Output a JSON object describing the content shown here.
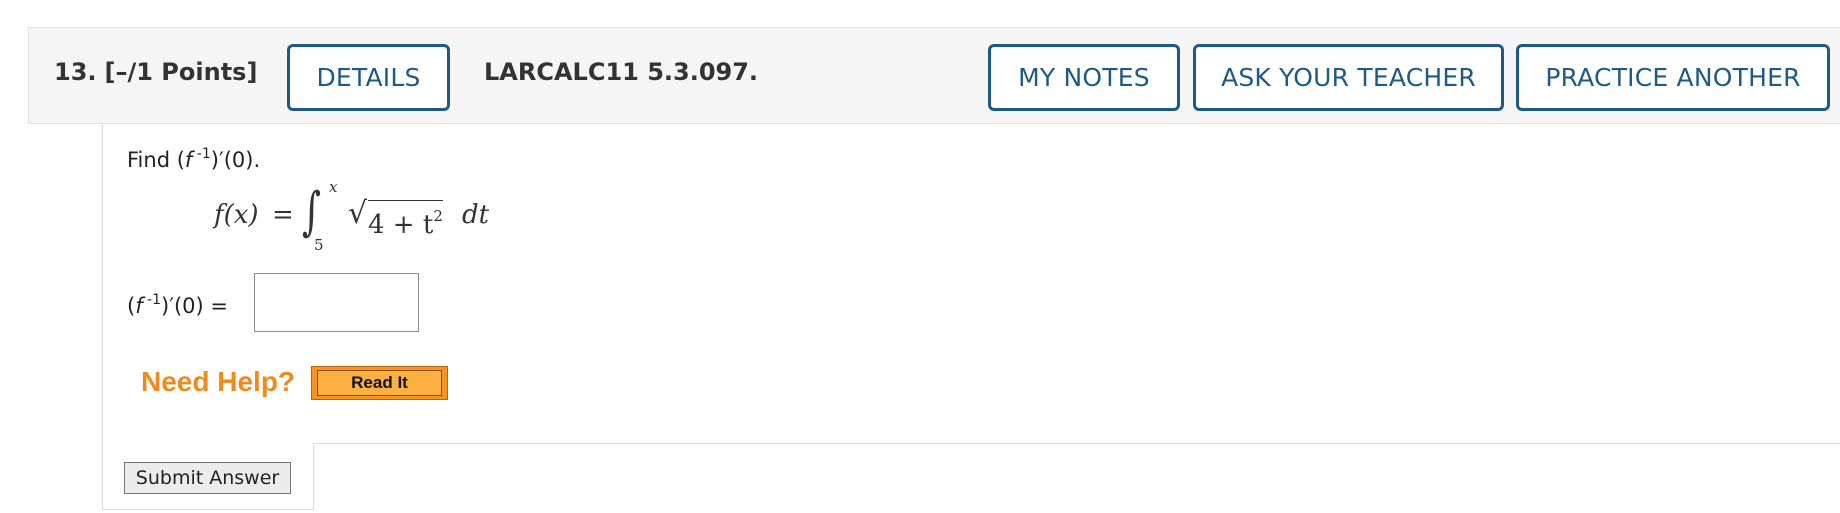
{
  "question": {
    "number": "13.",
    "points": "[–/1 Points]",
    "reference": "LARCALC11 5.3.097."
  },
  "buttons": {
    "details": "DETAILS",
    "my_notes": "MY NOTES",
    "ask_teacher": "ASK YOUR TEACHER",
    "practice_another": "PRACTICE ANOTHER"
  },
  "prompt": {
    "find_word": "Find",
    "open": "(",
    "f": "f",
    "sup": " -1",
    "close": ")′(0)."
  },
  "formula": {
    "lhs": "f(x)",
    "equals": "=",
    "integral": "∫",
    "upper_limit": "x",
    "lower_limit": "5",
    "sqrt": "√",
    "radicand_base": "4 + t",
    "radicand_exp": "2",
    "differential": "dt"
  },
  "answer": {
    "open": "(",
    "f": "f",
    "sup": " -1",
    "close": ")′(0) =",
    "value": ""
  },
  "help": {
    "label": "Need Help?",
    "read_it": "Read It"
  },
  "submit": {
    "label": "Submit Answer"
  },
  "colors": {
    "header_bg": "#f5f5f5",
    "button_blue": "#1f5a86",
    "need_help_orange": "#f08a1c",
    "read_it_orange": "#f7941d"
  }
}
